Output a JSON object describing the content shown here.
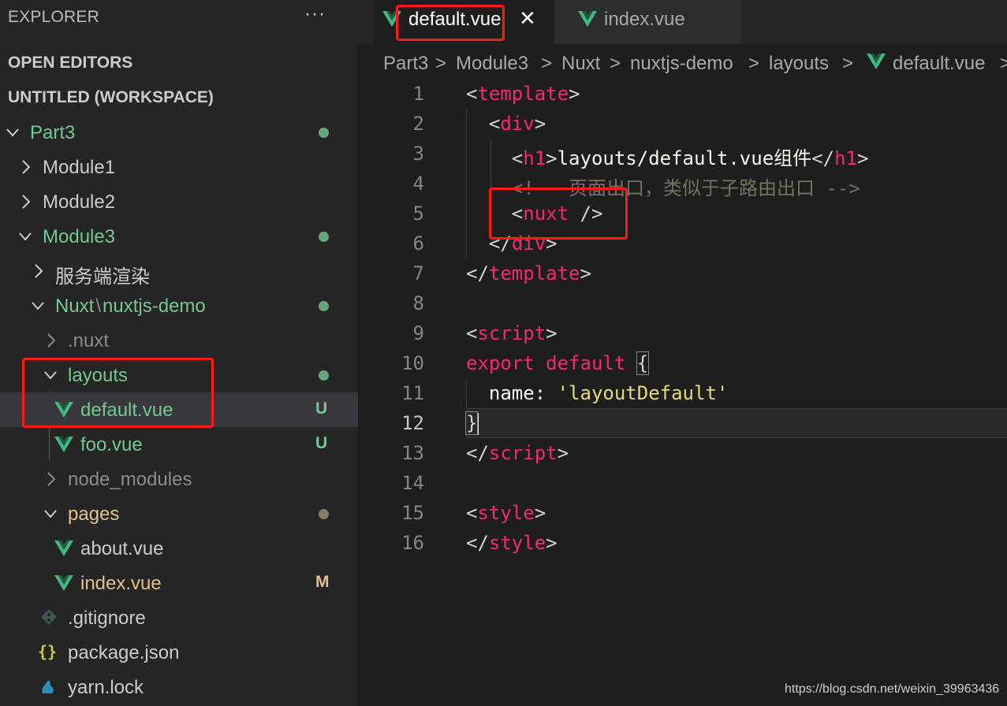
{
  "explorer": {
    "title": "EXPLORER",
    "more": "···",
    "open_editors": "OPEN EDITORS",
    "workspace": "UNTITLED (WORKSPACE)",
    "tree": [
      {
        "label": "Part3",
        "badge": ""
      },
      {
        "label": "Module1",
        "badge": ""
      },
      {
        "label": "Module2",
        "badge": ""
      },
      {
        "label": "Module3",
        "badge": ""
      },
      {
        "label": "服务端渲染",
        "badge": ""
      },
      {
        "label": "Nuxt",
        "sep": "\\",
        "label2": "nuxtjs-demo",
        "badge": ""
      },
      {
        "label": ".nuxt",
        "badge": ""
      },
      {
        "label": "layouts",
        "badge": ""
      },
      {
        "label": "default.vue",
        "badge": "U"
      },
      {
        "label": "foo.vue",
        "badge": "U"
      },
      {
        "label": "node_modules",
        "badge": ""
      },
      {
        "label": "pages",
        "badge": ""
      },
      {
        "label": "about.vue",
        "badge": ""
      },
      {
        "label": "index.vue",
        "badge": "M"
      },
      {
        "label": ".gitignore",
        "badge": ""
      },
      {
        "label": "package.json",
        "badge": ""
      },
      {
        "label": "yarn.lock",
        "badge": ""
      }
    ]
  },
  "tabs": [
    {
      "label": "default.vue",
      "close": "✕"
    },
    {
      "label": "index.vue"
    }
  ],
  "breadcrumb": [
    "Part3",
    "Module3",
    "Nuxt",
    "nuxtjs-demo",
    "layouts",
    "default.vue"
  ],
  "breadcrumb_sep": ">",
  "code": {
    "line_numbers": [
      "1",
      "2",
      "3",
      "4",
      "5",
      "6",
      "7",
      "8",
      "9",
      "10",
      "11",
      "12",
      "13",
      "14",
      "15",
      "16"
    ],
    "template_tag": "template",
    "div_tag": "div",
    "h1_tag": "h1",
    "h1_text": "layouts/default.vue组件",
    "comment": "<!-- 页面出口，类似于子路由出口 -->",
    "nuxt_tag": "nuxt",
    "script_tag": "script",
    "export_kw": "export",
    "default_kw": "default",
    "name_prop": "name",
    "name_value": "'layoutDefault'",
    "style_tag": "style"
  },
  "colors": {
    "vue_icon": "#41b883",
    "highlight_box": "#ff1a1a",
    "git_untracked": "#73c991",
    "git_modified": "#e2c08d"
  },
  "watermark": "https://blog.csdn.net/weixin_39963436"
}
